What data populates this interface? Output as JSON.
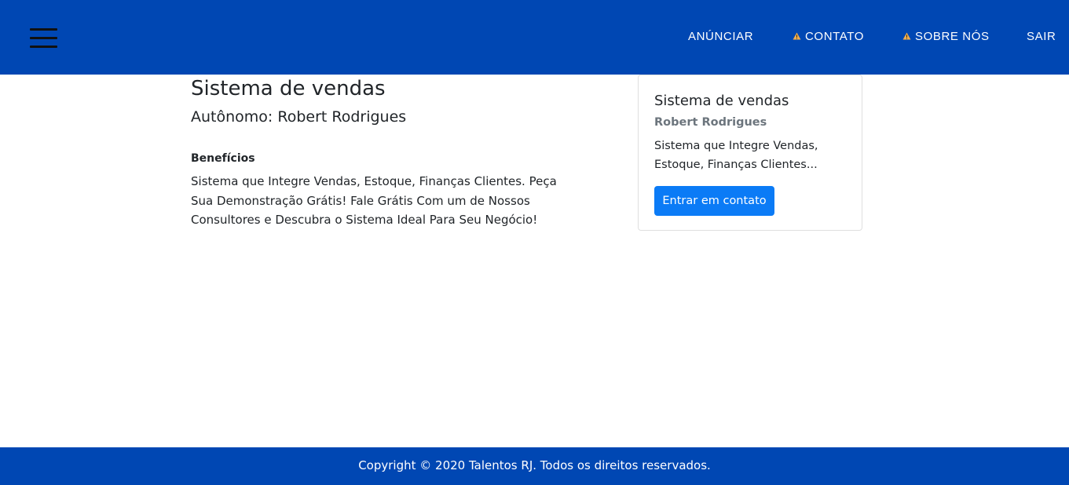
{
  "header": {
    "menu_icon": "hamburger-menu-icon",
    "nav": {
      "anunciar": "ANÚNCIAR",
      "contato": "CONTATO",
      "sobre": "SOBRE NÓS",
      "sair": "SAIR"
    },
    "warning_icon": "warning-triangle-icon",
    "warning_color": "#f0ad4e",
    "background_color": "#0047b3"
  },
  "main": {
    "title": "Sistema de vendas",
    "subtitle": "Autônomo: Robert Rodrigues",
    "benefits_label": "Benefícios",
    "benefits_text": "Sistema que Integre Vendas, Estoque, Finanças Clientes. Peça Sua Demonstração Grátis! Fale Grátis Com um de Nossos Consultores e Descubra o Sistema Ideal Para Seu Negócio!"
  },
  "card": {
    "title": "Sistema de vendas",
    "subtitle": "Robert Rodrigues",
    "text": "Sistema que Integre Vendas, Estoque, Finanças Clientes...",
    "button_label": "Entrar em contato",
    "button_color": "#0b7bf6"
  },
  "footer": {
    "text": "Copyright © 2020 Talentos RJ. Todos os direitos reservados."
  }
}
